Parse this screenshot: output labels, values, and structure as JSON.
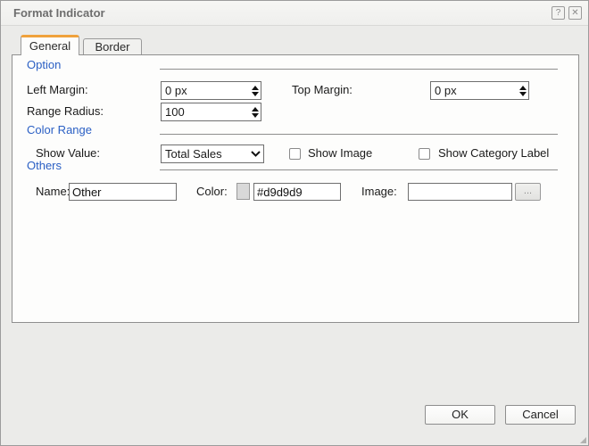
{
  "dialog": {
    "title": "Format Indicator",
    "help_label": "?",
    "close_label": "✕"
  },
  "tabs": {
    "general": {
      "label": "General",
      "active": true
    },
    "border": {
      "label": "Border",
      "active": false
    }
  },
  "sections": {
    "option": {
      "heading": "Option"
    },
    "color_range": {
      "heading": "Color Range"
    },
    "others": {
      "heading": "Others"
    }
  },
  "fields": {
    "left_margin": {
      "label": "Left Margin:",
      "value": "0 px"
    },
    "top_margin": {
      "label": "Top Margin:",
      "value": "0 px"
    },
    "range_radius": {
      "label": "Range Radius:",
      "value": "100"
    },
    "show_value": {
      "label": "Show Value:",
      "selected": "Total Sales"
    },
    "show_image": {
      "label": "Show Image",
      "checked": false
    },
    "show_category_label": {
      "label": "Show Category Label",
      "checked": false
    },
    "name": {
      "label": "Name:",
      "value": "Other"
    },
    "color": {
      "label": "Color:",
      "value": "#d9d9d9",
      "swatch": "#d9d9d9"
    },
    "image": {
      "label": "Image:",
      "value": "",
      "browse_label": "..."
    }
  },
  "buttons": {
    "ok": "OK",
    "cancel": "Cancel"
  },
  "colors": {
    "tab_accent": "#f0a23c",
    "section_heading": "#2a5fc4",
    "dialog_bg": "#ebebe9",
    "panel_bg": "#fdfdfc",
    "color_swatch": "#d9d9d9"
  }
}
